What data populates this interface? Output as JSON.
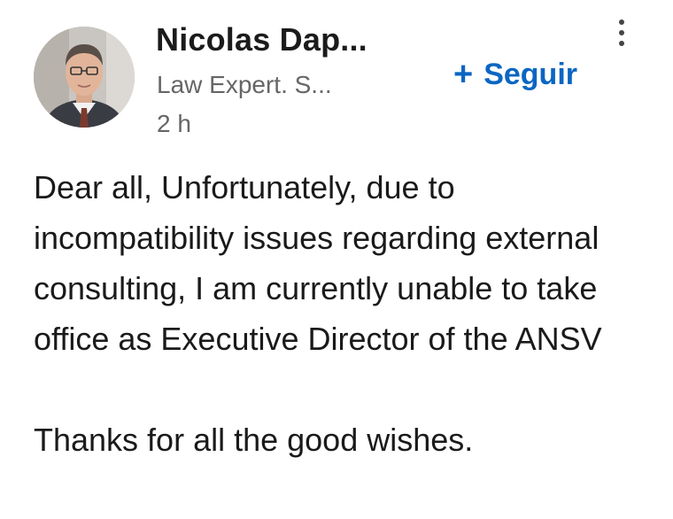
{
  "author": {
    "name": "Nicolas Dap...",
    "headline": "Law Expert. S...",
    "time": "2 h"
  },
  "actions": {
    "follow_label": "Seguir",
    "follow_icon": "plus-icon",
    "more_icon": "more-vertical-icon"
  },
  "post": {
    "paragraph_1": "Dear all, Unfortunately, due to incompatibility issues regarding external consulting, I am currently unable to take office as Executive Director of the ANSV",
    "paragraph_2": "Thanks for all the good wishes."
  },
  "colors": {
    "accent": "#0a66c2",
    "text_primary": "#1a1a1a",
    "text_secondary": "#666666",
    "background": "#ffffff"
  }
}
